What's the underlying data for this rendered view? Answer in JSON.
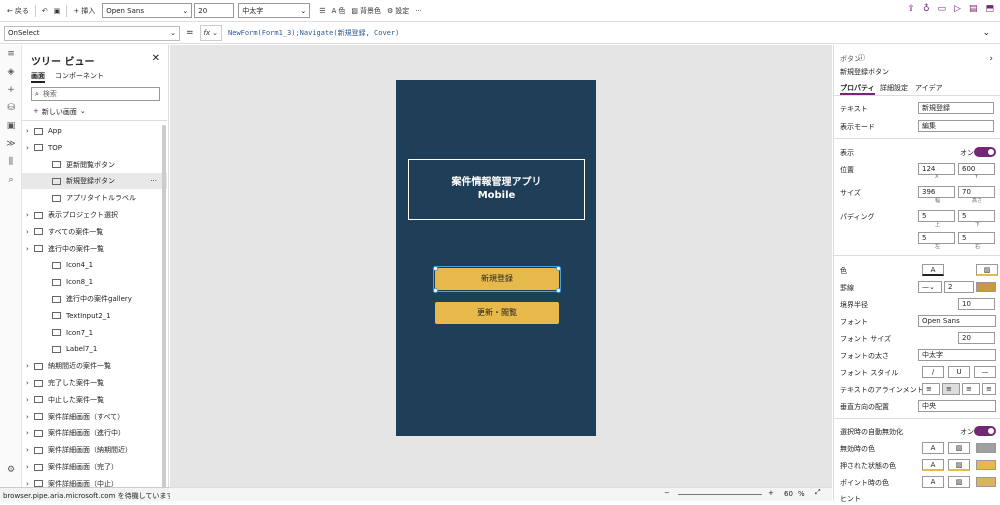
{
  "cmdbar": {
    "back": "戻る",
    "insert": "挿入",
    "font": "Open Sans",
    "size": "20",
    "weight": "中太字",
    "color": "色",
    "bg": "背景色",
    "settings": "設定"
  },
  "formula": {
    "property": "OnSelect",
    "fx": "fx",
    "code": "NewForm(Form1_3);Navigate(新規登録, Cover)"
  },
  "tree": {
    "title": "ツリー ビュー",
    "tab_screens": "画面",
    "tab_components": "コンポーネント",
    "search_placeholder": "検索",
    "new_screen": "新しい画面",
    "items": [
      {
        "label": "App",
        "indent": 0
      },
      {
        "label": "TOP",
        "indent": 0
      },
      {
        "label": "更新閲覧ボタン",
        "indent": 1
      },
      {
        "label": "新規登録ボタン",
        "indent": 1,
        "selected": true
      },
      {
        "label": "アプリタイトルラベル",
        "indent": 1
      },
      {
        "label": "表示プロジェクト選択",
        "indent": 0
      },
      {
        "label": "すべての案件一覧",
        "indent": 0
      },
      {
        "label": "進行中の案件一覧",
        "indent": 0
      },
      {
        "label": "Icon4_1",
        "indent": 1
      },
      {
        "label": "Icon8_1",
        "indent": 1
      },
      {
        "label": "進行中の案件gallery",
        "indent": 1
      },
      {
        "label": "TextInput2_1",
        "indent": 1
      },
      {
        "label": "Icon7_1",
        "indent": 1
      },
      {
        "label": "Label7_1",
        "indent": 1
      },
      {
        "label": "納期間近の案件一覧",
        "indent": 0
      },
      {
        "label": "完了した案件一覧",
        "indent": 0
      },
      {
        "label": "中止した案件一覧",
        "indent": 0
      },
      {
        "label": "案件詳細画面（すべて）",
        "indent": 0
      },
      {
        "label": "案件詳細画面（進行中）",
        "indent": 0
      },
      {
        "label": "案件詳細画面（納期間近）",
        "indent": 0
      },
      {
        "label": "案件詳細画面（完了）",
        "indent": 0
      },
      {
        "label": "案件詳細画面（中止）",
        "indent": 0
      }
    ]
  },
  "screen": {
    "title_line1": "案件情報管理アプリ",
    "title_line2": "Mobile",
    "btn_new": "新規登録",
    "btn_update": "更新・閲覧"
  },
  "status": {
    "text": "browser.pipe.aria.microsoft.com を待機しています...",
    "zoom": "60",
    "zoom_unit": "%"
  },
  "props": {
    "type": "ボタン",
    "name": "新規登録ボタン",
    "tabs": [
      "プロパティ",
      "詳細設定",
      "アイデア"
    ],
    "text_label": "テキスト",
    "text_value": "新規登録",
    "display_mode_label": "表示モード",
    "display_mode": "編集",
    "visible_label": "表示",
    "visible_value": "オン",
    "position_label": "位置",
    "pos_x": "124",
    "pos_y": "600",
    "x": "X",
    "y": "Y",
    "size_label": "サイズ",
    "width": "396",
    "height": "70",
    "w": "幅",
    "h": "高さ",
    "padding_label": "パディング",
    "pad_top": "5",
    "pad_bottom": "5",
    "pad_left": "5",
    "pad_right": "5",
    "pad_t": "上",
    "pad_b": "下",
    "pad_l": "左",
    "pad_r": "右",
    "color_label": "色",
    "border_label": "罫線",
    "border_width": "2",
    "radius_label": "境界半径",
    "radius": "10",
    "font_label": "フォント",
    "font_value": "Open Sans",
    "fontsize_label": "フォント サイズ",
    "font_size": "20",
    "weight_label": "フォントの太さ",
    "weight_value": "中太字",
    "style_label": "フォント スタイル",
    "align_label": "テキストのアラインメント",
    "valign_label": "垂直方向の配置",
    "valign_value": "中央",
    "autodisable_label": "選択時の自動無効化",
    "autodisable_value": "オン",
    "disabled_color_label": "無効時の色",
    "pressed_color_label": "押された状態の色",
    "hover_color_label": "ポイント時の色",
    "tooltip_label": "ヒント"
  }
}
